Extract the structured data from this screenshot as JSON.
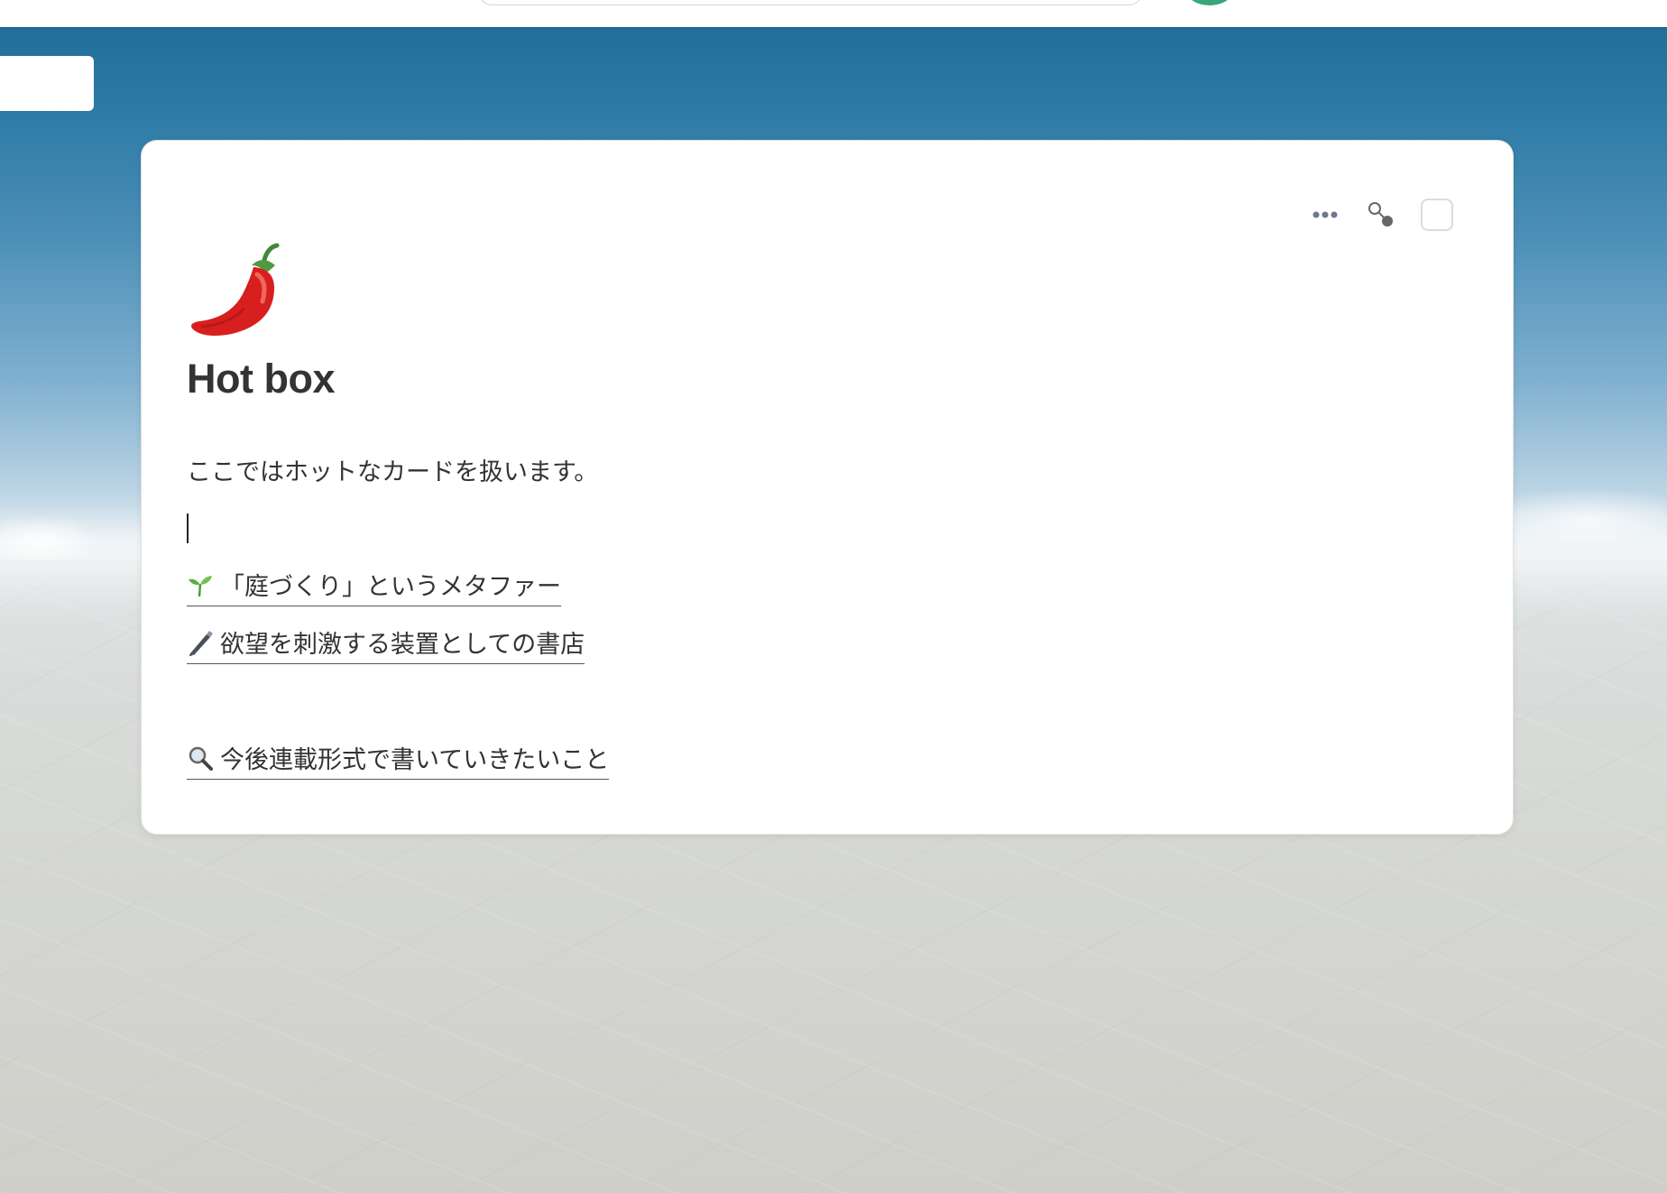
{
  "card": {
    "emoji": "hot-pepper-emoji",
    "title": "Hot box",
    "description": "ここではホットなカードを扱います。",
    "links": [
      {
        "icon": "seedling-icon",
        "label": "「庭づくり」というメタファー"
      },
      {
        "icon": "pen-icon",
        "label": "欲望を刺激する装置としての書店"
      },
      {
        "icon": "magnifier-icon",
        "label": "今後連載形式で書いていきたいこと"
      }
    ],
    "actions": [
      "more-options-icon",
      "connect-icon",
      "checkbox"
    ]
  },
  "colors": {
    "accent_pepper": "#d81f1f",
    "text": "#333333",
    "icon": "#6f7692"
  }
}
